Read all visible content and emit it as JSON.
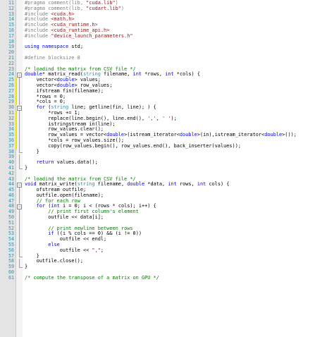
{
  "editor": {
    "lines": [
      {
        "n": "11",
        "fold": "",
        "tokens": [
          {
            "c": "pp",
            "t": "#pragma comment(lib, "
          },
          {
            "c": "str",
            "t": "\"cuda.lib\""
          },
          {
            "c": "pp",
            "t": ")"
          }
        ]
      },
      {
        "n": "12",
        "fold": "",
        "tokens": [
          {
            "c": "pp",
            "t": "#pragma comment(lib, "
          },
          {
            "c": "str",
            "t": "\"cudart.lib\""
          },
          {
            "c": "pp",
            "t": ")"
          }
        ]
      },
      {
        "n": "13",
        "fold": "",
        "tokens": [
          {
            "c": "pp",
            "t": "#include "
          },
          {
            "c": "str",
            "t": "<cuda.h>"
          }
        ]
      },
      {
        "n": "14",
        "fold": "",
        "tokens": [
          {
            "c": "pp",
            "t": "#include "
          },
          {
            "c": "str",
            "t": "<math.h>"
          }
        ]
      },
      {
        "n": "15",
        "fold": "",
        "tokens": [
          {
            "c": "pp",
            "t": "#include "
          },
          {
            "c": "str",
            "t": "<cuda_runtime.h>"
          }
        ]
      },
      {
        "n": "16",
        "fold": "",
        "tokens": [
          {
            "c": "pp",
            "t": "#include "
          },
          {
            "c": "str",
            "t": "<cuda_runtime_api.h>"
          }
        ]
      },
      {
        "n": "17",
        "fold": "",
        "tokens": [
          {
            "c": "pp",
            "t": "#include "
          },
          {
            "c": "str",
            "t": "\"device_launch_parameters.h\""
          }
        ]
      },
      {
        "n": "18",
        "fold": "",
        "tokens": []
      },
      {
        "n": "19",
        "fold": "",
        "tokens": [
          {
            "c": "kw",
            "t": "using namespace"
          },
          {
            "c": "op",
            "t": " std;"
          }
        ]
      },
      {
        "n": "20",
        "fold": "",
        "tokens": []
      },
      {
        "n": "21",
        "fold": "",
        "tokens": [
          {
            "c": "pp",
            "t": "#define blocksize 8"
          }
        ]
      },
      {
        "n": "22",
        "fold": "",
        "tokens": []
      },
      {
        "n": "23",
        "fold": "",
        "tokens": [
          {
            "c": "cm",
            "t": "/* loadind the matrix from CSV file */"
          }
        ]
      },
      {
        "n": "24",
        "fold": "open",
        "tokens": [
          {
            "c": "kw",
            "t": "double"
          },
          {
            "c": "op",
            "t": "* matrix_read("
          },
          {
            "c": "ty",
            "t": "string"
          },
          {
            "c": "op",
            "t": " filename, "
          },
          {
            "c": "kw",
            "t": "int"
          },
          {
            "c": "op",
            "t": " *rows, "
          },
          {
            "c": "kw",
            "t": "int"
          },
          {
            "c": "op",
            "t": " *cols) {"
          }
        ]
      },
      {
        "n": "25",
        "fold": "line",
        "tokens": [
          {
            "c": "op",
            "t": "    vector<"
          },
          {
            "c": "kw",
            "t": "double"
          },
          {
            "c": "op",
            "t": "> values;"
          }
        ]
      },
      {
        "n": "26",
        "fold": "line",
        "tokens": [
          {
            "c": "op",
            "t": "    vector<"
          },
          {
            "c": "kw",
            "t": "double"
          },
          {
            "c": "op",
            "t": "> row_values;"
          }
        ]
      },
      {
        "n": "27",
        "fold": "line",
        "tokens": [
          {
            "c": "op",
            "t": "    ifstream fin(filename);"
          }
        ]
      },
      {
        "n": "28",
        "fold": "line",
        "tokens": [
          {
            "c": "op",
            "t": "    *rows = "
          },
          {
            "c": "num",
            "t": "0"
          },
          {
            "c": "op",
            "t": ";"
          }
        ]
      },
      {
        "n": "29",
        "fold": "line",
        "tokens": [
          {
            "c": "op",
            "t": "    *cols = "
          },
          {
            "c": "num",
            "t": "0"
          },
          {
            "c": "op",
            "t": ";"
          }
        ]
      },
      {
        "n": "30",
        "fold": "open",
        "tokens": [
          {
            "c": "op",
            "t": "    "
          },
          {
            "c": "kw",
            "t": "for"
          },
          {
            "c": "op",
            "t": " ("
          },
          {
            "c": "ty",
            "t": "string"
          },
          {
            "c": "op",
            "t": " line; getline(fin, line); ) {"
          }
        ]
      },
      {
        "n": "31",
        "fold": "line",
        "tokens": [
          {
            "c": "op",
            "t": "        *rows += "
          },
          {
            "c": "num",
            "t": "1"
          },
          {
            "c": "op",
            "t": ";"
          }
        ]
      },
      {
        "n": "32",
        "fold": "line",
        "tokens": [
          {
            "c": "op",
            "t": "        replace(line.begin(), line.end(), "
          },
          {
            "c": "str",
            "t": "','"
          },
          {
            "c": "op",
            "t": ", "
          },
          {
            "c": "str",
            "t": "' '"
          },
          {
            "c": "op",
            "t": ");"
          }
        ]
      },
      {
        "n": "33",
        "fold": "line",
        "tokens": [
          {
            "c": "op",
            "t": "        istringstream in(line);"
          }
        ]
      },
      {
        "n": "34",
        "fold": "line",
        "tokens": [
          {
            "c": "op",
            "t": "        row_values.clear();"
          }
        ]
      },
      {
        "n": "35",
        "fold": "line",
        "tokens": [
          {
            "c": "op",
            "t": "        row_values = vector<"
          },
          {
            "c": "kw",
            "t": "double"
          },
          {
            "c": "op",
            "t": ">(istream_iterator<"
          },
          {
            "c": "kw",
            "t": "double"
          },
          {
            "c": "op",
            "t": ">(in),istream_iterator<"
          },
          {
            "c": "kw",
            "t": "double"
          },
          {
            "c": "op",
            "t": ">());"
          }
        ]
      },
      {
        "n": "36",
        "fold": "line",
        "tokens": [
          {
            "c": "op",
            "t": "        *cols = row_values.size();"
          }
        ]
      },
      {
        "n": "37",
        "fold": "line",
        "tokens": [
          {
            "c": "op",
            "t": "        copy(row_values.begin(), row_values.end(), back_inserter(values));"
          }
        ]
      },
      {
        "n": "38",
        "fold": "end",
        "tokens": [
          {
            "c": "op",
            "t": "    }"
          }
        ]
      },
      {
        "n": "39",
        "fold": "line",
        "tokens": []
      },
      {
        "n": "40",
        "fold": "line",
        "tokens": [
          {
            "c": "op",
            "t": "    "
          },
          {
            "c": "kw",
            "t": "return"
          },
          {
            "c": "op",
            "t": " values.data();"
          }
        ]
      },
      {
        "n": "41",
        "fold": "end",
        "tokens": [
          {
            "c": "op",
            "t": "}"
          }
        ]
      },
      {
        "n": "42",
        "fold": "",
        "tokens": []
      },
      {
        "n": "43",
        "fold": "",
        "tokens": [
          {
            "c": "cm",
            "t": "/* loadind the matrix from CSV file */"
          }
        ]
      },
      {
        "n": "44",
        "fold": "open",
        "tokens": [
          {
            "c": "kw",
            "t": "void"
          },
          {
            "c": "op",
            "t": " matrix_write("
          },
          {
            "c": "ty",
            "t": "string"
          },
          {
            "c": "op",
            "t": " filename, "
          },
          {
            "c": "kw",
            "t": "double"
          },
          {
            "c": "op",
            "t": " *data, "
          },
          {
            "c": "kw",
            "t": "int"
          },
          {
            "c": "op",
            "t": " rows, "
          },
          {
            "c": "kw",
            "t": "int"
          },
          {
            "c": "op",
            "t": " cols) {"
          }
        ]
      },
      {
        "n": "45",
        "fold": "line",
        "tokens": [
          {
            "c": "op",
            "t": "    ofstream outfile;"
          }
        ]
      },
      {
        "n": "46",
        "fold": "line",
        "tokens": [
          {
            "c": "op",
            "t": "    outfile.open(filename);"
          }
        ]
      },
      {
        "n": "47",
        "fold": "line",
        "tokens": [
          {
            "c": "op",
            "t": "    "
          },
          {
            "c": "cm",
            "t": "// for each row"
          }
        ]
      },
      {
        "n": "48",
        "fold": "open",
        "tokens": [
          {
            "c": "op",
            "t": "    "
          },
          {
            "c": "kw",
            "t": "for"
          },
          {
            "c": "op",
            "t": " ("
          },
          {
            "c": "kw",
            "t": "int"
          },
          {
            "c": "op",
            "t": " i = "
          },
          {
            "c": "num",
            "t": "0"
          },
          {
            "c": "op",
            "t": "; i < (rows * cols); i++) {"
          }
        ]
      },
      {
        "n": "49",
        "fold": "line",
        "tokens": [
          {
            "c": "op",
            "t": "        "
          },
          {
            "c": "cm",
            "t": "// print first column's element"
          }
        ]
      },
      {
        "n": "50",
        "fold": "line",
        "tokens": [
          {
            "c": "op",
            "t": "        outfile << data[i];"
          }
        ]
      },
      {
        "n": "51",
        "fold": "line",
        "tokens": []
      },
      {
        "n": "52",
        "fold": "line",
        "tokens": [
          {
            "c": "op",
            "t": "        "
          },
          {
            "c": "cm",
            "t": "// print newline between rows"
          }
        ]
      },
      {
        "n": "53",
        "fold": "line",
        "tokens": [
          {
            "c": "op",
            "t": "        "
          },
          {
            "c": "kw",
            "t": "if"
          },
          {
            "c": "op",
            "t": " ((i % cols == "
          },
          {
            "c": "num",
            "t": "0"
          },
          {
            "c": "op",
            "t": ") && (i != "
          },
          {
            "c": "num",
            "t": "0"
          },
          {
            "c": "op",
            "t": "))"
          }
        ]
      },
      {
        "n": "54",
        "fold": "line",
        "tokens": [
          {
            "c": "op",
            "t": "            outfile << endl;"
          }
        ]
      },
      {
        "n": "55",
        "fold": "line",
        "tokens": [
          {
            "c": "op",
            "t": "        "
          },
          {
            "c": "kw",
            "t": "else"
          }
        ]
      },
      {
        "n": "56",
        "fold": "line",
        "tokens": [
          {
            "c": "op",
            "t": "            outfile << "
          },
          {
            "c": "str",
            "t": "\",\""
          },
          {
            "c": "op",
            "t": ";"
          }
        ]
      },
      {
        "n": "57",
        "fold": "end",
        "tokens": [
          {
            "c": "op",
            "t": "    }"
          }
        ]
      },
      {
        "n": "58",
        "fold": "line",
        "tokens": [
          {
            "c": "op",
            "t": "    outfile.close();"
          }
        ]
      },
      {
        "n": "59",
        "fold": "end",
        "tokens": [
          {
            "c": "op",
            "t": "}"
          }
        ]
      },
      {
        "n": "60",
        "fold": "",
        "tokens": []
      },
      {
        "n": "61",
        "fold": "",
        "tokens": [
          {
            "c": "cm",
            "t": "/* compute the transpose of a matrix on GPU */"
          }
        ]
      }
    ],
    "colors": {
      "keyword": "#0000ff",
      "preprocessor": "#808080",
      "string": "#a31515",
      "comment": "#008000",
      "type": "#2b91af",
      "line_number": "#2b91af",
      "change_marker": "#e6e600"
    }
  }
}
